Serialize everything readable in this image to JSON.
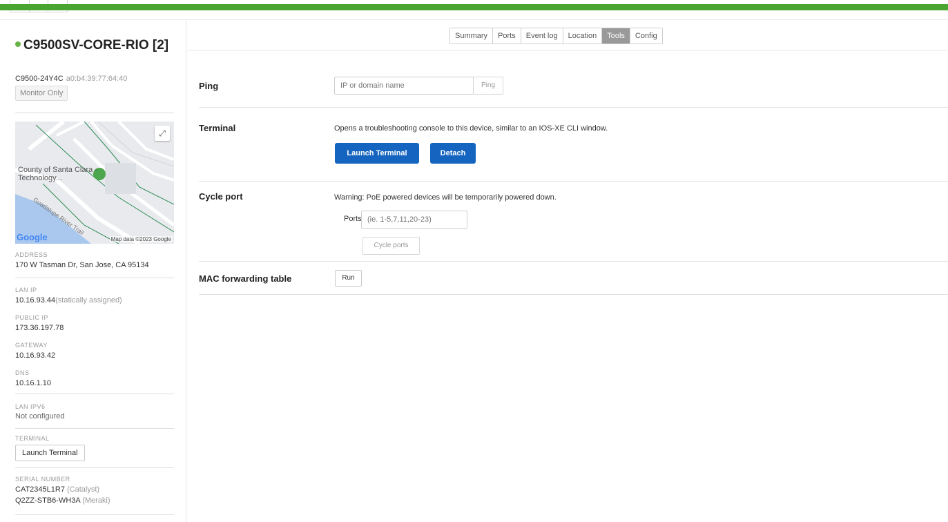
{
  "device": {
    "name": "C9500SV-CORE-RIO [2]",
    "model": "C9500-24Y4C",
    "mac": "a0:b4:39:77:64:40",
    "mode_badge": "Monitor Only",
    "status_color": "#67b346"
  },
  "map": {
    "place_label": "County of Santa Clara - Technology...",
    "road_label": "Guadalupe River Trail",
    "logo": "Google",
    "attribution": "Map data ©2023 Google",
    "expand_icon": "expand-icon"
  },
  "sidebar": {
    "address_label": "ADDRESS",
    "address": "170 W Tasman Dr, San Jose, CA 95134",
    "lan_ip_label": "LAN IP",
    "lan_ip": "10.16.93.44",
    "lan_ip_note": "(statically assigned)",
    "public_ip_label": "PUBLIC IP",
    "public_ip": "173.36.197.78",
    "gateway_label": "GATEWAY",
    "gateway": "10.16.93.42",
    "dns_label": "DNS",
    "dns": "10.16.1.10",
    "lan_ipv6_label": "LAN IPV6",
    "lan_ipv6": "Not configured",
    "terminal_label": "TERMINAL",
    "terminal_button": "Launch Terminal",
    "serial_label": "SERIAL NUMBER",
    "serial_1": "CAT2345L1R7",
    "serial_1_note": "(Catalyst)",
    "serial_2": "Q2ZZ-STB6-WH3A",
    "serial_2_note": "(Meraki)"
  },
  "tabs": [
    {
      "label": "Summary"
    },
    {
      "label": "Ports"
    },
    {
      "label": "Event log"
    },
    {
      "label": "Location"
    },
    {
      "label": "Tools",
      "active": true
    },
    {
      "label": "Config"
    }
  ],
  "tools": {
    "ping": {
      "title": "Ping",
      "placeholder": "IP or domain name",
      "button": "Ping"
    },
    "terminal": {
      "title": "Terminal",
      "description": "Opens a troubleshooting console to this device, similar to an IOS-XE CLI window.",
      "launch_button": "Launch Terminal",
      "detach_button": "Detach"
    },
    "cycle_port": {
      "title": "Cycle port",
      "warning": "Warning: PoE powered devices will be temporarily powered down.",
      "ports_label": "Ports",
      "ports_placeholder": "(ie. 1-5,7,11,20-23)",
      "button": "Cycle ports"
    },
    "mac_table": {
      "title": "MAC forwarding table",
      "button": "Run"
    }
  },
  "colors": {
    "brand_green": "#4aa530",
    "primary_blue": "#1565c0",
    "active_tab": "#999999"
  }
}
